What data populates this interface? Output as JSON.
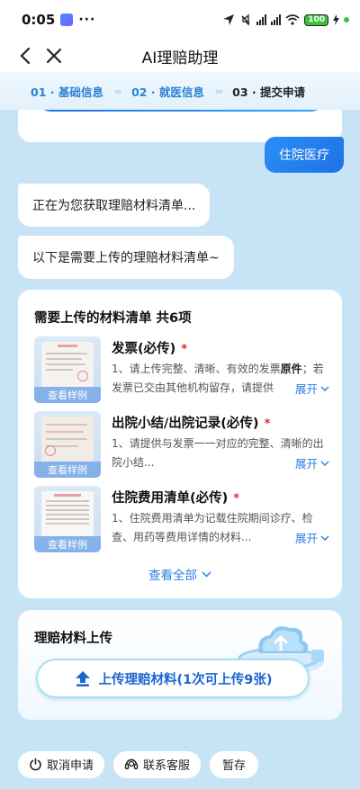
{
  "status_bar": {
    "time": "0:05",
    "more": "···",
    "battery": "100"
  },
  "nav": {
    "title": "AI理赔助理"
  },
  "steps": [
    {
      "label": "01 · 基础信息"
    },
    {
      "label": "02 · 就医信息"
    },
    {
      "label": "03 · 提交申请"
    }
  ],
  "chat": {
    "user_message": "住院医疗",
    "bot_message_1": "正在为您获取理赔材料清单...",
    "bot_message_2": "以下是需要上传的理赔材料清单~"
  },
  "materials": {
    "heading": "需要上传的材料清单 共6项",
    "sample_label": "查看样例",
    "expand_label": "展开",
    "required_mark": "*",
    "view_all": "查看全部",
    "items": [
      {
        "title": "发票(必传)",
        "desc_prefix": "1、请上传完整、清晰、有效的发票",
        "desc_bold": "原件",
        "desc_suffix": "；若发票已交由其他机构留存，请提供"
      },
      {
        "title": "出院小结/出院记录(必传)",
        "desc": "1、请提供与发票一一对应的完整、清晰的出院小结..."
      },
      {
        "title": "住院费用清单(必传)",
        "desc": "1、住院费用清单为记载住院期间诊疗、检查、用药等费用详情的材料..."
      }
    ]
  },
  "upload": {
    "title": "理赔材料上传",
    "button_label": "上传理赔材料(1次可上传9张)"
  },
  "bottom_actions": {
    "cancel": "取消申请",
    "service": "联系客服",
    "save": "暂存"
  },
  "colors": {
    "accent": "#2a7ee0",
    "background": "#c7e4f7",
    "required": "#e02a2a"
  }
}
